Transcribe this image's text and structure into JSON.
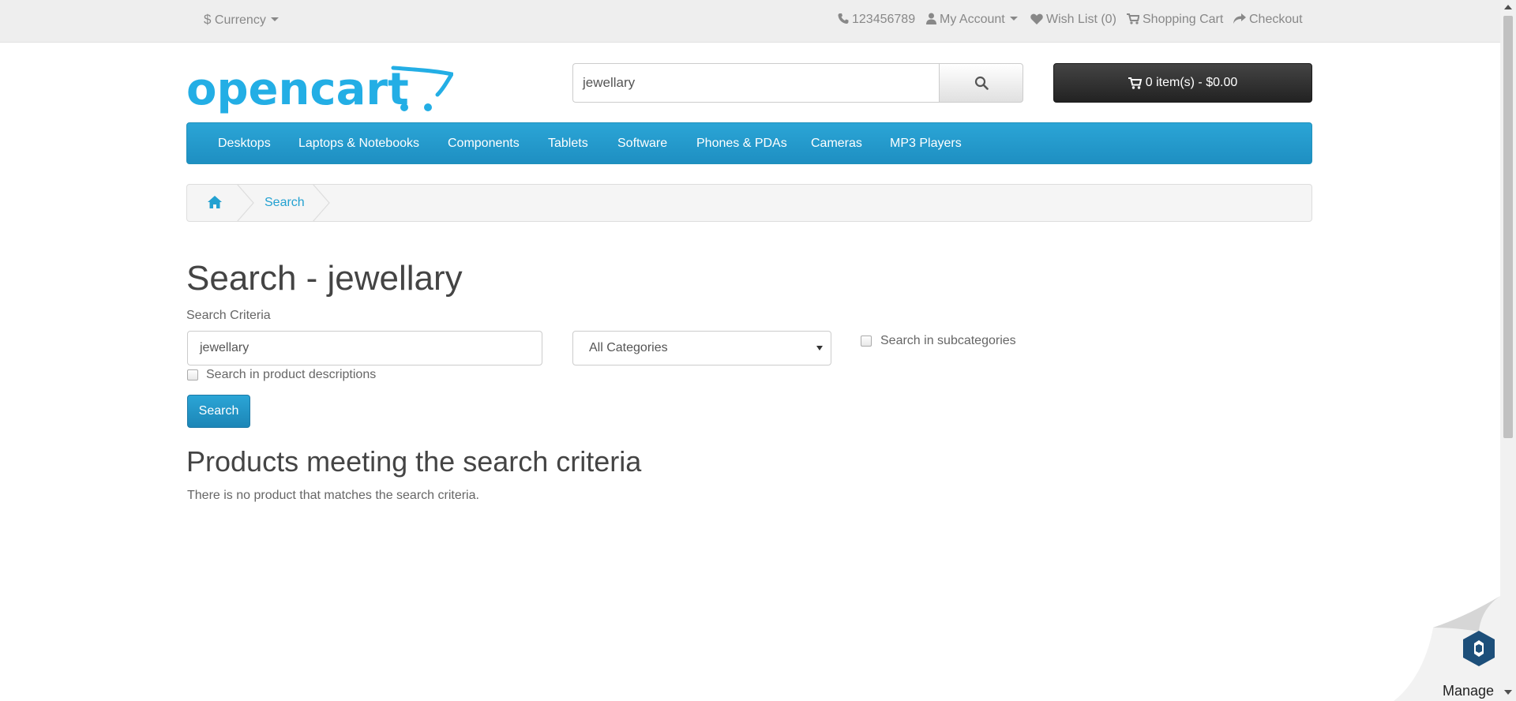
{
  "topbar": {
    "currency_label": "Currency",
    "phone": "123456789",
    "my_account": "My Account",
    "wishlist": "Wish List (0)",
    "shopping_cart": "Shopping Cart",
    "checkout": "Checkout"
  },
  "header": {
    "logo_text": "opencart",
    "search_value": "jewellary",
    "cart_summary": "0 item(s) - $0.00"
  },
  "nav": {
    "items": [
      "Desktops",
      "Laptops & Notebooks",
      "Components",
      "Tablets",
      "Software",
      "Phones & PDAs",
      "Cameras",
      "MP3 Players"
    ]
  },
  "breadcrumb": {
    "current": "Search"
  },
  "content": {
    "title": "Search - jewellary",
    "criteria_label": "Search Criteria",
    "criteria_value": "jewellary",
    "category_selected": "All Categories",
    "subcategories_label": "Search in subcategories",
    "descriptions_label": "Search in product descriptions",
    "search_button": "Search",
    "results_title": "Products meeting the search criteria",
    "empty_message": "There is no product that matches the search criteria."
  },
  "widget": {
    "manage_label": "Manage"
  },
  "colors": {
    "accent": "#229ac8",
    "topbar_bg": "#eeeeee",
    "cart_bg": "#303030",
    "link": "#23a1d1"
  },
  "icons": [
    "dollar-icon",
    "phone-icon",
    "user-icon",
    "heart-icon",
    "cart-icon",
    "share-icon",
    "search-icon",
    "home-icon"
  ]
}
